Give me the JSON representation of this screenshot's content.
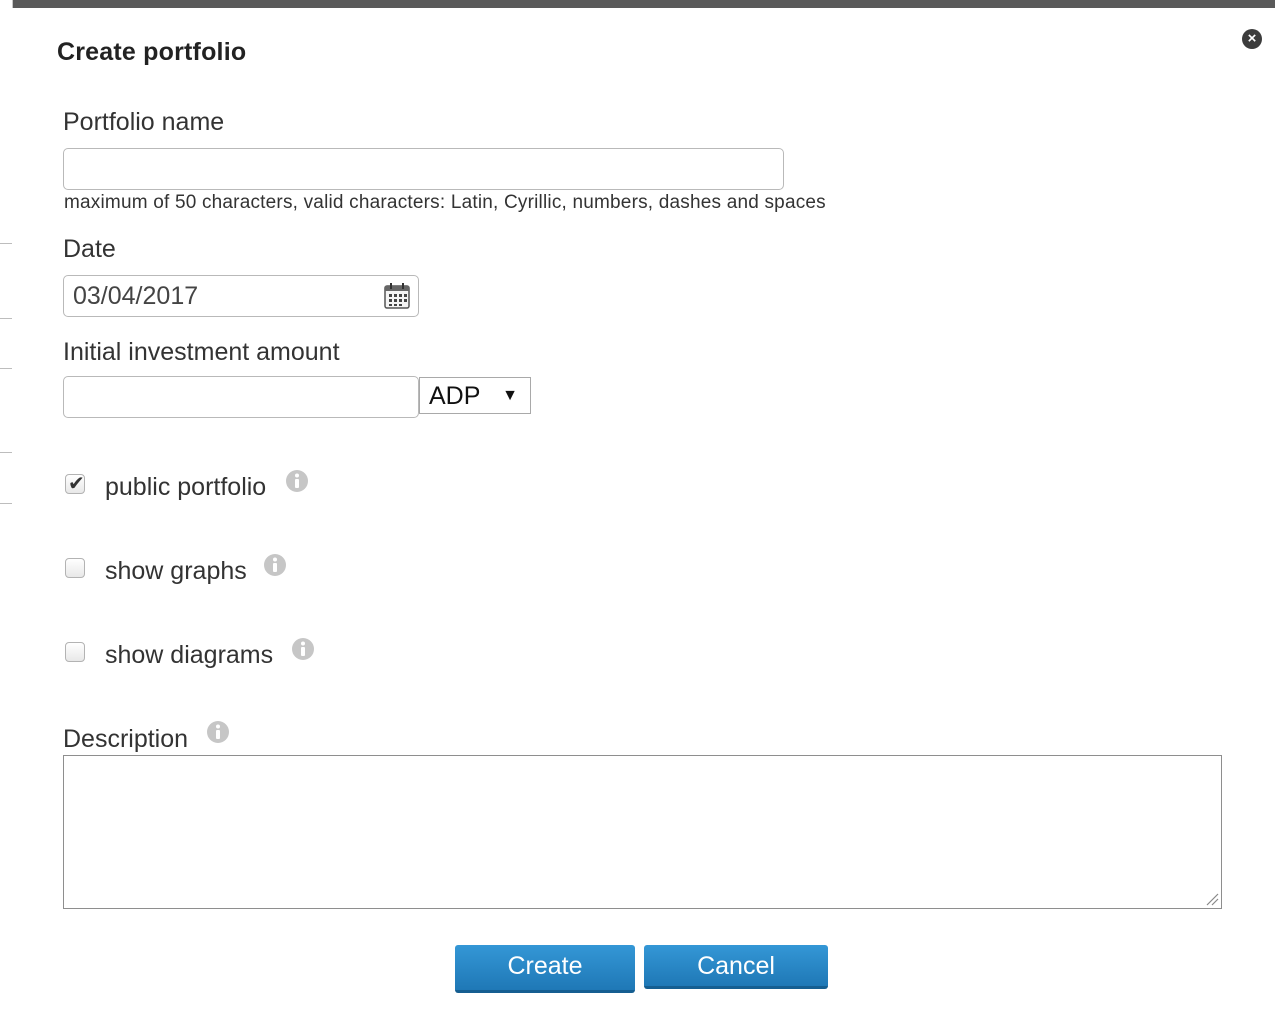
{
  "dialog": {
    "title": "Create portfolio",
    "close_label": "×"
  },
  "form": {
    "portfolio_name": {
      "label": "Portfolio name",
      "value": "",
      "hint": "maximum of 50 characters, valid characters: Latin, Cyrillic, numbers, dashes and spaces"
    },
    "date": {
      "label": "Date",
      "value": "03/04/2017",
      "icon": "calendar-icon"
    },
    "initial_investment": {
      "label": "Initial investment amount",
      "value": "",
      "currency": "ADP",
      "arrow": "▼"
    },
    "checkboxes": [
      {
        "label": "public portfolio",
        "checked": true,
        "icon": "info-icon"
      },
      {
        "label": "show graphs",
        "checked": false,
        "icon": "info-icon"
      },
      {
        "label": "show diagrams",
        "checked": false,
        "icon": "info-icon"
      }
    ],
    "description": {
      "label": "Description",
      "value": "",
      "icon": "info-icon"
    }
  },
  "buttons": {
    "create_label": "Create",
    "cancel_label": "Cancel"
  },
  "colors": {
    "button_blue": "#2a88c8",
    "info_icon_gray": "#c4c4c4"
  }
}
